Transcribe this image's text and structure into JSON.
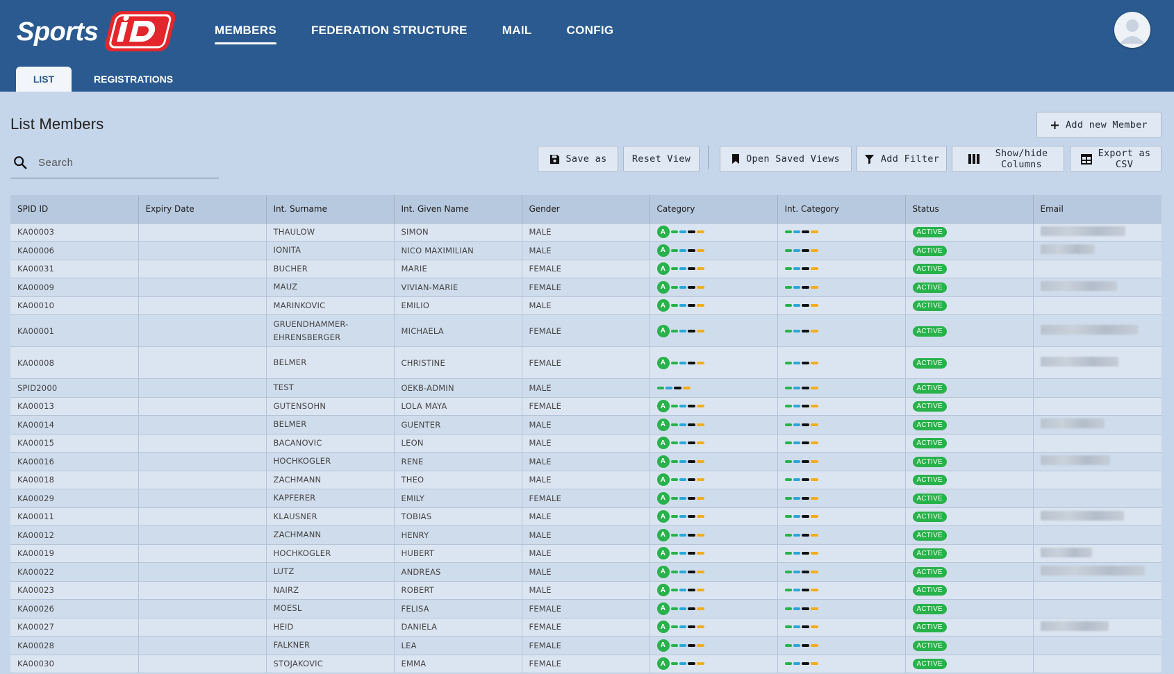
{
  "app": {
    "logo_text": "SportsID"
  },
  "nav": {
    "items": [
      {
        "label": "MEMBERS",
        "active": true
      },
      {
        "label": "FEDERATION STRUCTURE",
        "active": false
      },
      {
        "label": "MAIL",
        "active": false
      },
      {
        "label": "CONFIG",
        "active": false
      }
    ]
  },
  "subtabs": {
    "list": "LIST",
    "registrations": "REGISTRATIONS"
  },
  "page": {
    "title": "List Members"
  },
  "search": {
    "placeholder": "Search"
  },
  "toolbar": {
    "add_new_member": "Add new Member",
    "save_as": "Save as",
    "reset_view": "Reset View",
    "open_saved_views": "Open Saved Views",
    "add_filter": "Add Filter",
    "show_hide_columns_1": "Show/hide",
    "show_hide_columns_2": "Columns",
    "export_csv_1": "Export as",
    "export_csv_2": "CSV"
  },
  "colors": {
    "header_bg": "#2a5a8f",
    "page_bg": "#c6d6ea",
    "status_active": "#27b24a",
    "logo_red": "#e3262b"
  },
  "table": {
    "columns": [
      "SPID ID",
      "Expiry Date",
      "Int. Surname",
      "Int. Given Name",
      "Gender",
      "Category",
      "Int. Category",
      "Status",
      "Email"
    ],
    "category_badge": "A",
    "rows": [
      {
        "id": "KA00003",
        "expiry": "",
        "surname": "THAULOW",
        "given": "SIMON",
        "gender": "MALE",
        "badge": true,
        "status": "ACTIVE",
        "email_w": 122
      },
      {
        "id": "KA00006",
        "expiry": "",
        "surname": "IONITA",
        "given": "NICO MAXIMILIAN",
        "gender": "MALE",
        "badge": true,
        "status": "ACTIVE",
        "email_w": 78
      },
      {
        "id": "KA00031",
        "expiry": "",
        "surname": "BUCHER",
        "given": "MARIE",
        "gender": "FEMALE",
        "badge": true,
        "status": "ACTIVE",
        "email_w": 0
      },
      {
        "id": "KA00009",
        "expiry": "",
        "surname": "MAUZ",
        "given": "VIVIAN-MARIE",
        "gender": "FEMALE",
        "badge": true,
        "status": "ACTIVE",
        "email_w": 110
      },
      {
        "id": "KA00010",
        "expiry": "",
        "surname": "MARINKOVIC",
        "given": "EMILIO",
        "gender": "MALE",
        "badge": true,
        "status": "ACTIVE",
        "email_w": 0
      },
      {
        "id": "KA00001",
        "expiry": "",
        "surname": "GRUENDHAMMER-EHRENSBERGER",
        "given": "MICHAELA",
        "gender": "FEMALE",
        "badge": true,
        "status": "ACTIVE",
        "email_w": 140,
        "tall": true
      },
      {
        "id": "KA00008",
        "expiry": "",
        "surname": "BELMER",
        "given": "CHRISTINE",
        "gender": "FEMALE",
        "badge": true,
        "status": "ACTIVE",
        "email_w": 112,
        "tall": true
      },
      {
        "id": "SPID2000",
        "expiry": "",
        "surname": "TEST",
        "given": "OEKB-ADMIN",
        "gender": "MALE",
        "badge": false,
        "status": "ACTIVE",
        "email_w": 0
      },
      {
        "id": "KA00013",
        "expiry": "",
        "surname": "GUTENSOHN",
        "given": "LOLA MAYA",
        "gender": "FEMALE",
        "badge": true,
        "status": "ACTIVE",
        "email_w": 0
      },
      {
        "id": "KA00014",
        "expiry": "",
        "surname": "BELMER",
        "given": "GUENTER",
        "gender": "MALE",
        "badge": true,
        "status": "ACTIVE",
        "email_w": 92
      },
      {
        "id": "KA00015",
        "expiry": "",
        "surname": "BACANOVIC",
        "given": "LEON",
        "gender": "MALE",
        "badge": true,
        "status": "ACTIVE",
        "email_w": 0
      },
      {
        "id": "KA00016",
        "expiry": "",
        "surname": "HOCHKOGLER",
        "given": "RENE",
        "gender": "MALE",
        "badge": true,
        "status": "ACTIVE",
        "email_w": 100
      },
      {
        "id": "KA00018",
        "expiry": "",
        "surname": "ZACHMANN",
        "given": "THEO",
        "gender": "MALE",
        "badge": true,
        "status": "ACTIVE",
        "email_w": 0
      },
      {
        "id": "KA00029",
        "expiry": "",
        "surname": "KAPFERER",
        "given": "EMILY",
        "gender": "FEMALE",
        "badge": true,
        "status": "ACTIVE",
        "email_w": 0
      },
      {
        "id": "KA00011",
        "expiry": "",
        "surname": "KLAUSNER",
        "given": "TOBIAS",
        "gender": "MALE",
        "badge": true,
        "status": "ACTIVE",
        "email_w": 120
      },
      {
        "id": "KA00012",
        "expiry": "",
        "surname": "ZACHMANN",
        "given": "HENRY",
        "gender": "MALE",
        "badge": true,
        "status": "ACTIVE",
        "email_w": 0
      },
      {
        "id": "KA00019",
        "expiry": "",
        "surname": "HOCHKOGLER",
        "given": "HUBERT",
        "gender": "MALE",
        "badge": true,
        "status": "ACTIVE",
        "email_w": 74
      },
      {
        "id": "KA00022",
        "expiry": "",
        "surname": "LUTZ",
        "given": "ANDREAS",
        "gender": "MALE",
        "badge": true,
        "status": "ACTIVE",
        "email_w": 150
      },
      {
        "id": "KA00023",
        "expiry": "",
        "surname": "NAIRZ",
        "given": "ROBERT",
        "gender": "MALE",
        "badge": true,
        "status": "ACTIVE",
        "email_w": 0
      },
      {
        "id": "KA00026",
        "expiry": "",
        "surname": "MOESL",
        "given": "FELISA",
        "gender": "FEMALE",
        "badge": true,
        "status": "ACTIVE",
        "email_w": 0
      },
      {
        "id": "KA00027",
        "expiry": "",
        "surname": "HEID",
        "given": "DANIELA",
        "gender": "FEMALE",
        "badge": true,
        "status": "ACTIVE",
        "email_w": 98
      },
      {
        "id": "KA00028",
        "expiry": "",
        "surname": "FALKNER",
        "given": "LEA",
        "gender": "FEMALE",
        "badge": true,
        "status": "ACTIVE",
        "email_w": 0
      },
      {
        "id": "KA00030",
        "expiry": "",
        "surname": "STOJAKOVIC",
        "given": "EMMA",
        "gender": "FEMALE",
        "badge": true,
        "status": "ACTIVE",
        "email_w": 0
      }
    ]
  }
}
